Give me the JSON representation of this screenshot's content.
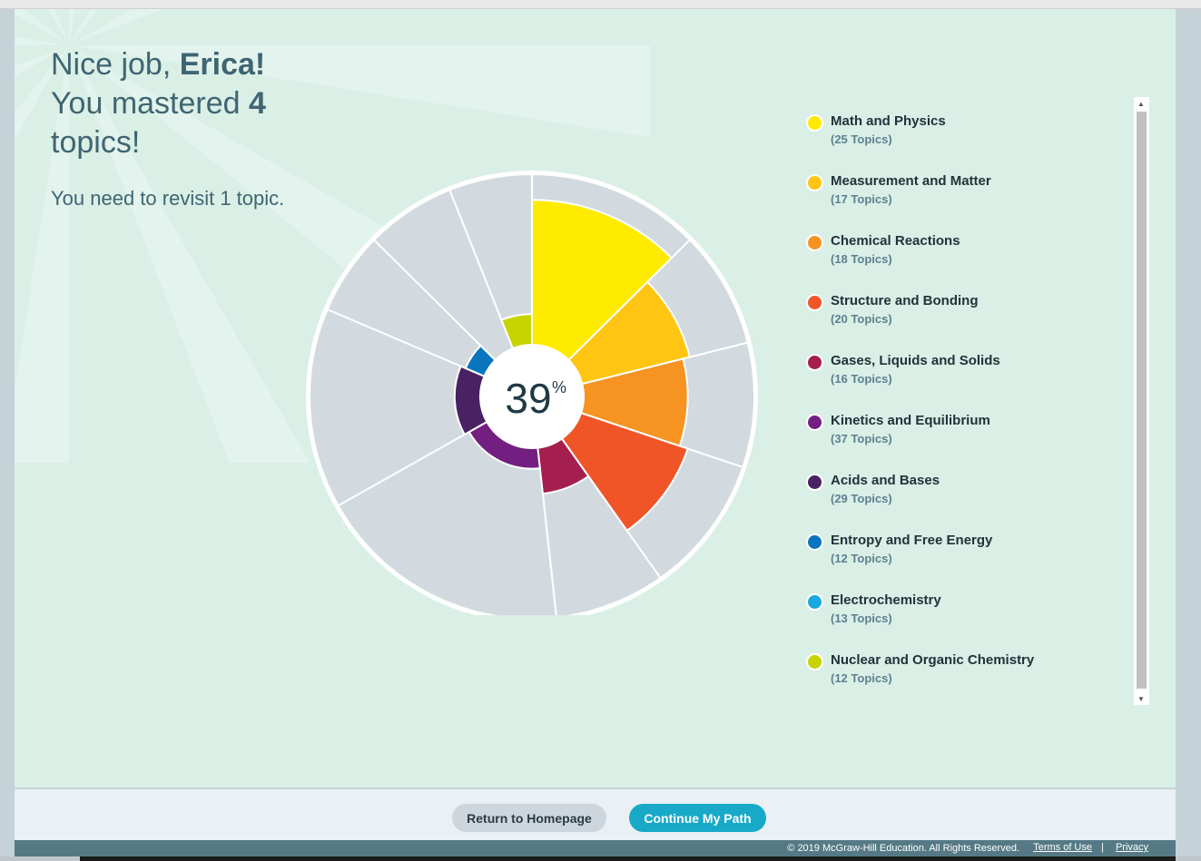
{
  "header": {
    "greeting_prefix": "Nice job, ",
    "student_name": "Erica!",
    "mastered_prefix": "You mastered ",
    "mastered_count": "4",
    "mastered_suffix": "topics!",
    "revisit_text": "You need to revisit 1 topic."
  },
  "chart_data": {
    "type": "pie",
    "center_value": "39",
    "center_unit": "%",
    "segments": [
      {
        "name": "Math and Physics",
        "topics": 25,
        "mastery": 0.85,
        "color": "#ffeb00"
      },
      {
        "name": "Measurement and Matter",
        "topics": 17,
        "mastery": 0.65,
        "color": "#ffc512"
      },
      {
        "name": "Chemical Reactions",
        "topics": 18,
        "mastery": 0.61,
        "color": "#f69321"
      },
      {
        "name": "Structure and Bonding",
        "topics": 20,
        "mastery": 0.66,
        "color": "#f05528"
      },
      {
        "name": "Gases, Liquids and Solids",
        "topics": 16,
        "mastery": 0.27,
        "color": "#a41f4d"
      },
      {
        "name": "Kinetics and Equilibrium",
        "topics": 37,
        "mastery": 0.12,
        "color": "#731f81"
      },
      {
        "name": "Acids and Bases",
        "topics": 29,
        "mastery": 0.15,
        "color": "#4a2163"
      },
      {
        "name": "Entropy and Free Energy",
        "topics": 12,
        "mastery": 0.12,
        "color": "#0a75bf"
      },
      {
        "name": "Electrochemistry",
        "topics": 13,
        "mastery": 0.0,
        "color": "#1aa9df"
      },
      {
        "name": "Nuclear and Organic Chemistry",
        "topics": 12,
        "mastery": 0.18,
        "color": "#c8d400"
      }
    ],
    "remaining_color": "#d2dadf"
  },
  "legend": {
    "items": [
      {
        "name": "Math and Physics",
        "count": "(25 Topics)",
        "color": "#ffeb00"
      },
      {
        "name": "Measurement and Matter",
        "count": "(17 Topics)",
        "color": "#ffc512"
      },
      {
        "name": "Chemical Reactions",
        "count": "(18 Topics)",
        "color": "#f69321"
      },
      {
        "name": "Structure and Bonding",
        "count": "(20 Topics)",
        "color": "#f05528"
      },
      {
        "name": "Gases, Liquids and Solids",
        "count": "(16 Topics)",
        "color": "#a41f4d"
      },
      {
        "name": "Kinetics and Equilibrium",
        "count": "(37 Topics)",
        "color": "#731f81"
      },
      {
        "name": "Acids and Bases",
        "count": "(29 Topics)",
        "color": "#4a2163"
      },
      {
        "name": "Entropy and Free Energy",
        "count": "(12 Topics)",
        "color": "#0a75bf"
      },
      {
        "name": "Electrochemistry",
        "count": "(13 Topics)",
        "color": "#1aa9df"
      },
      {
        "name": "Nuclear and Organic Chemistry",
        "count": "(12 Topics)",
        "color": "#c8d400"
      }
    ]
  },
  "footer": {
    "home_label": "Return to Homepage",
    "continue_label": "Continue My Path"
  },
  "copyright": {
    "text": "© 2019 McGraw-Hill Education. All Rights Reserved.",
    "terms": "Terms of Use",
    "separator": "|",
    "privacy": "Privacy"
  },
  "scrollbar": {
    "up_icon": "▲",
    "down_icon": "▼"
  }
}
